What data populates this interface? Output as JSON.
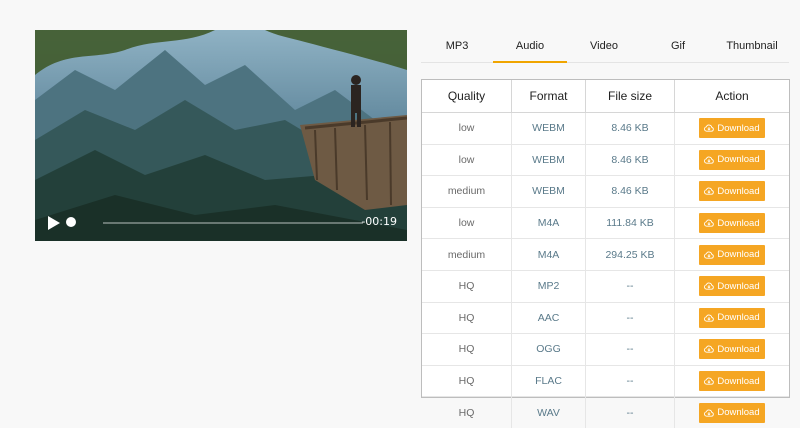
{
  "video": {
    "time_remaining": "-00:19",
    "progress": 0.02
  },
  "tabs": [
    {
      "label": "MP3",
      "active": false
    },
    {
      "label": "Audio",
      "active": true
    },
    {
      "label": "Video",
      "active": false
    },
    {
      "label": "Gif",
      "active": false
    },
    {
      "label": "Thumbnail",
      "active": false
    }
  ],
  "table": {
    "headers": [
      "Quality",
      "Format",
      "File size",
      "Action"
    ],
    "rows": [
      {
        "quality": "low",
        "format": "WEBM",
        "size": "8.46 KB",
        "action": "Download"
      },
      {
        "quality": "low",
        "format": "WEBM",
        "size": "8.46 KB",
        "action": "Download"
      },
      {
        "quality": "medium",
        "format": "WEBM",
        "size": "8.46 KB",
        "action": "Download"
      },
      {
        "quality": "low",
        "format": "M4A",
        "size": "111.84 KB",
        "action": "Download"
      },
      {
        "quality": "medium",
        "format": "M4A",
        "size": "294.25 KB",
        "action": "Download"
      },
      {
        "quality": "HQ",
        "format": "MP2",
        "size": "--",
        "action": "Download"
      },
      {
        "quality": "HQ",
        "format": "AAC",
        "size": "--",
        "action": "Download"
      },
      {
        "quality": "HQ",
        "format": "OGG",
        "size": "--",
        "action": "Download"
      },
      {
        "quality": "HQ",
        "format": "FLAC",
        "size": "--",
        "action": "Download"
      },
      {
        "quality": "HQ",
        "format": "WAV",
        "size": "--",
        "action": "Download"
      }
    ]
  },
  "colors": {
    "accent": "#f5a623",
    "tab_underline": "#f0a500"
  }
}
